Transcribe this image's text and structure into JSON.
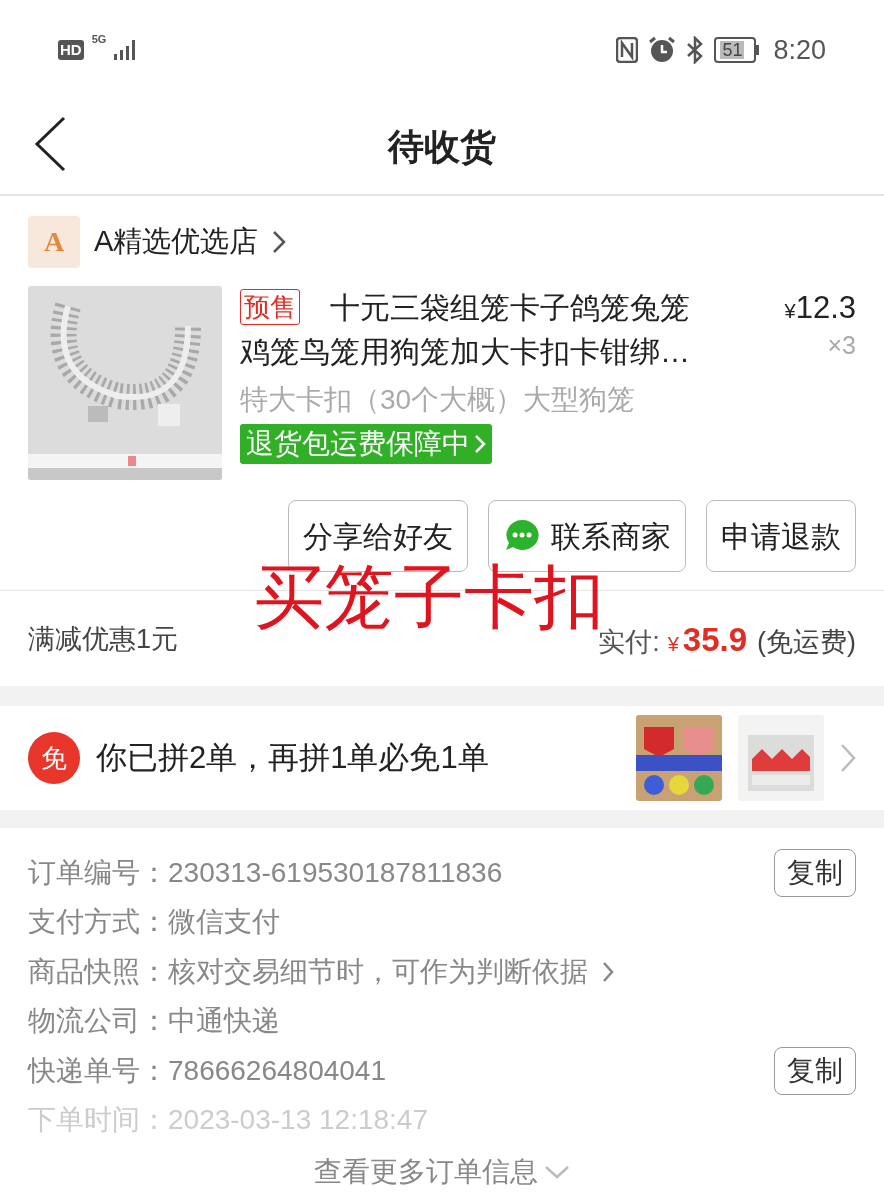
{
  "status_bar": {
    "hd": "HD",
    "network": "5G",
    "battery": "51",
    "time": "8:20"
  },
  "header": {
    "title": "待收货"
  },
  "shop": {
    "logo": "A",
    "name": "A精选优选店"
  },
  "product": {
    "tag": "预售",
    "title": "十元三袋组笼卡子鸽笼兔笼鸡笼鸟笼用狗笼加大卡扣卡钳绑…",
    "spec": "特大卡扣（30个大概）大型狗笼",
    "badge": "退货包运费保障中",
    "currency": "¥",
    "price": "12.3",
    "quantity": "×3"
  },
  "actions": [
    {
      "label": "分享给好友",
      "kind": "plain"
    },
    {
      "label": "联系商家",
      "kind": "chat"
    },
    {
      "label": "申请退款",
      "kind": "plain"
    }
  ],
  "annotation": "买笼子卡扣",
  "summary": {
    "discount": "满减优惠1元",
    "paid_label": "实付:",
    "currency": "¥",
    "paid": "35.9",
    "shipping": "(免运费)"
  },
  "promo": {
    "icon": "免",
    "text": "你已拼2单，再拼1单必免1单"
  },
  "order_info": [
    {
      "label": "订单编号：",
      "value": "230313-619530187811836",
      "copy": "复制",
      "faded": false
    },
    {
      "label": "支付方式：",
      "value": "微信支付",
      "faded": false
    },
    {
      "label": "商品快照：",
      "value": "核对交易细节时，可作为判断依据",
      "link": true,
      "faded": false
    },
    {
      "label": "物流公司：",
      "value": "中通快递",
      "faded": false
    },
    {
      "label": "快递单号：",
      "value": "78666264804041",
      "copy": "复制",
      "faded": false
    },
    {
      "label": "下单时间：",
      "value": "2023-03-13 12:18:47",
      "faded": true
    }
  ],
  "more": "查看更多订单信息"
}
